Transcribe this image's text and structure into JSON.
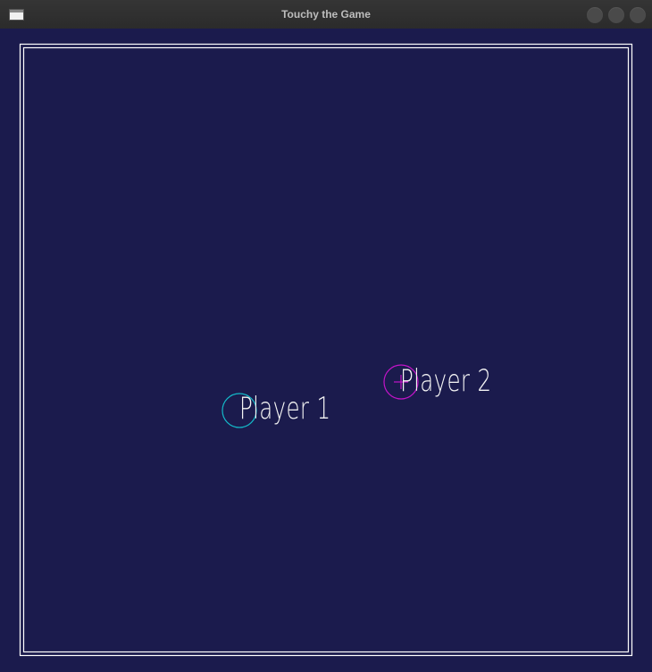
{
  "window": {
    "title": "Touchy the Game",
    "icons": [
      "app-window-icon",
      "minimize-icon",
      "maximize-icon",
      "close-icon"
    ]
  },
  "game": {
    "background_color": "#1b1b4d",
    "border_color": "#ffffff",
    "players": [
      {
        "label": "Player 1",
        "color": "#14b8c8"
      },
      {
        "label": "Player 2",
        "color": "#c214c8"
      }
    ]
  }
}
